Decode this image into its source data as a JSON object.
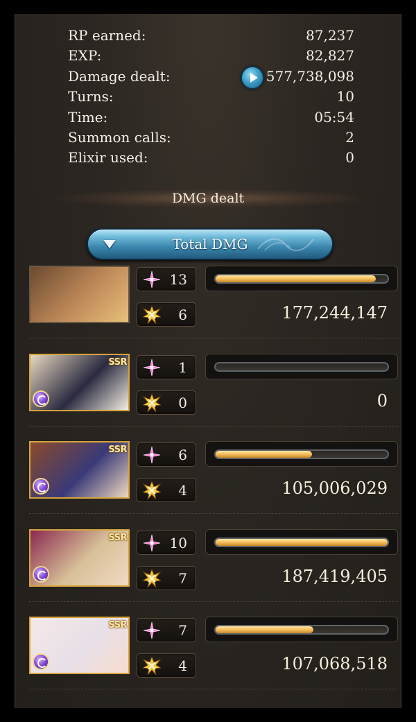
{
  "stats": [
    {
      "label": "RP earned:",
      "value": "87,237"
    },
    {
      "label": "EXP:",
      "value": "82,827"
    },
    {
      "label": "Damage dealt:",
      "value": "577,738,098",
      "icon": "play-icon"
    },
    {
      "label": "Turns:",
      "value": "10"
    },
    {
      "label": "Time:",
      "value": "05:54"
    },
    {
      "label": "Summon calls:",
      "value": "2"
    },
    {
      "label": "Elixir used:",
      "value": "0"
    }
  ],
  "section_title": "DMG dealt",
  "dropdown": {
    "label": "Total DMG",
    "icon": "triangle-down-icon"
  },
  "characters": [
    {
      "name": "main-character",
      "ssr": false,
      "element_icon": false,
      "skills": "13",
      "ougi": "6",
      "bar_fraction": 0.93,
      "damage": "177,244,147",
      "art": [
        "#6b4a30",
        "#c08a5a",
        "#e8c07a"
      ]
    },
    {
      "name": "dark-elf",
      "ssr": true,
      "ssr_label": "SSR",
      "element_icon": true,
      "element": "dark",
      "skills": "1",
      "ougi": "0",
      "bar_fraction": 0.0,
      "damage": "0",
      "art": [
        "#e8d8c0",
        "#2a2a40",
        "#f5efe3"
      ]
    },
    {
      "name": "nun-girl",
      "ssr": true,
      "ssr_label": "SSR",
      "element_icon": true,
      "element": "dark",
      "skills": "6",
      "ougi": "4",
      "bar_fraction": 0.56,
      "damage": "105,006,029",
      "art": [
        "#8a4a2a",
        "#3a3a78",
        "#f0d9c0"
      ]
    },
    {
      "name": "blond-man",
      "ssr": true,
      "ssr_label": "SSR",
      "element_icon": true,
      "element": "dark",
      "skills": "10",
      "ougi": "7",
      "bar_fraction": 1.0,
      "damage": "187,419,405",
      "art": [
        "#8a2a50",
        "#d8c098",
        "#f1d9c4"
      ]
    },
    {
      "name": "white-hair-girl",
      "ssr": true,
      "ssr_label": "SSR",
      "element_icon": true,
      "element": "dark",
      "skills": "7",
      "ougi": "4",
      "bar_fraction": 0.57,
      "damage": "107,068,518",
      "art": [
        "#f4e8e8",
        "#e8e0e8",
        "#f6dcd0"
      ]
    }
  ],
  "colors": {
    "bar_fill": "#f3be5a",
    "skill_icon": "#ff7ae0",
    "ougi_icon": "#f4c94a",
    "dropdown": "#3b86ad"
  }
}
